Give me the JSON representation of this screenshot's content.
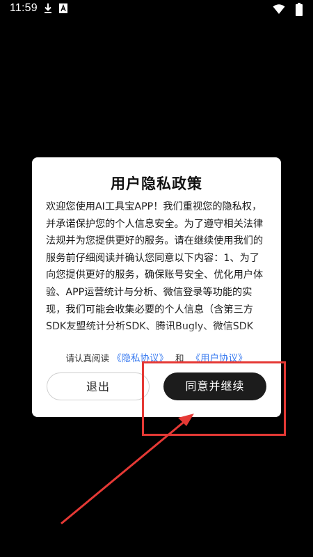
{
  "status_bar": {
    "time": "11:59",
    "icons": [
      "download-icon",
      "text-a-icon",
      "wifi-icon",
      "battery-icon"
    ]
  },
  "dialog": {
    "title": "用户隐私政策",
    "body": "欢迎您使用AI工具宝APP！我们重视您的隐私权，并承诺保护您的个人信息安全。为了遵守相关法律法规并为您提供更好的服务。请在继续使用我们的服务前仔细阅读并确认您同意以下内容：1、为了向您提供更好的服务，确保账号安全、优化用户体验、APP运营统计与分析、微信登录等功能的实现，我们可能会收集必要的个人信息（含第三方SDK友盟统计分析SDK、腾讯Bugly、微信SDK",
    "agree_prefix": "请认真阅读",
    "privacy_link": "《隐私协议》",
    "and_text": "和",
    "user_link": "《用户协议》",
    "exit_button": "退出",
    "agree_button": "同意并继续"
  },
  "colors": {
    "background": "#000000",
    "link": "#3b7cf0",
    "primary_button": "#1c1c1c",
    "annotation": "#e53935"
  }
}
